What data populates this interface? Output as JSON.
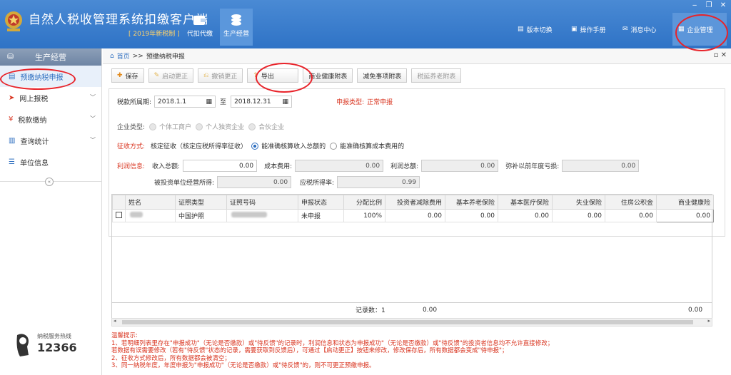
{
  "app": {
    "title": "自然人税收管理系统扣缴客户端",
    "subtitle": "[ 2019年新税制 ]"
  },
  "modules": [
    {
      "label": "代扣代缴",
      "icon": "wallet-icon"
    },
    {
      "label": "生产经营",
      "icon": "coins-icon"
    }
  ],
  "top_buttons": {
    "version": "版本切换",
    "manual": "操作手册",
    "messages": "消息中心",
    "enterprise": "企业管理"
  },
  "sidebar": {
    "header": "生产经营",
    "items": [
      {
        "label": "预缴纳税申报",
        "icon": "clipboard-icon"
      },
      {
        "label": "网上报税",
        "icon": "send-icon"
      },
      {
        "label": "税款缴纳",
        "icon": "money-icon"
      },
      {
        "label": "查询统计",
        "icon": "report-icon"
      },
      {
        "label": "单位信息",
        "icon": "list-icon"
      }
    ],
    "hotline_label": "纳税服务热线",
    "hotline_number": "12366"
  },
  "breadcrumb": {
    "home": "首页",
    "sep": ">>",
    "current": "预缴纳税申报"
  },
  "toolbar": {
    "save": "保存",
    "start_correction": "启动更正",
    "cancel_correction": "撤销更正",
    "export": "导出",
    "health_insurance": "商业健康附表",
    "deduction": "减免事项附表",
    "pension": "税延养老附表"
  },
  "form": {
    "period_label": "税款所属期:",
    "period_from": "2018.1.1",
    "period_to_sep": "至",
    "period_to": "2018.12.31",
    "declare_type_label": "申报类型:",
    "declare_type_value": "正常申报",
    "enterprise_type_label": "企业类型:",
    "enterprise_types": [
      "个体工商户",
      "个人独资企业",
      "合伙企业"
    ],
    "levy_label": "征收方式:",
    "levy_prefix": "核定征收（核定应税所得率征收）",
    "levy_options": [
      "能准确核算收入总额的",
      "能准确核算成本费用的"
    ],
    "profit_label": "利润信息:",
    "revenue_label": "收入总额:",
    "revenue": "0.00",
    "cost_label": "成本费用:",
    "cost": "0.00",
    "profit_total_label": "利润总额:",
    "profit_total": "0.00",
    "loss_label": "弥补以前年度亏损:",
    "loss": "0.00",
    "invested_income_label": "被投资单位经营所得:",
    "invested_income": "0.00",
    "tax_rate_label": "应税所得率:",
    "tax_rate": "0.99"
  },
  "table": {
    "headers": [
      "姓名",
      "证照类型",
      "证照号码",
      "申报状态",
      "分配比例",
      "投资者减除费用",
      "基本养老保险",
      "基本医疗保险",
      "失业保险",
      "住房公积金",
      "商业健康险"
    ],
    "rows": [
      {
        "id_type": "中国护照",
        "status": "未申报",
        "ratio": "100%",
        "deduct": "0.00",
        "pension": "0.00",
        "medical": "0.00",
        "unemploy": "0.00",
        "housing": "0.00",
        "health": "0.00"
      }
    ],
    "record_count_label": "记录数：1",
    "sum_deduct": "0.00",
    "sum_health": "0.00"
  },
  "tips": {
    "title": "温馨提示:",
    "lines": [
      "1、若明细列表里存在\"申报成功\"（无论是否缴款）或\"待反馈\"的记录时，利润信息和状态为申报成功\"（无论是否缴款）或\"待反馈\"的投资者信息均不允许直接修改；",
      "     若数据有误需要修改（若有\"待反馈\"状态的记录，需要获取到反馈后），可通过【启动更正】按钮来修改，修改保存后，所有数据都会变成\"待申报\"；",
      "2、征收方式修改后，所有数据都会被清空；",
      "3、同一纳税年度，年度申报为\"申报成功\"（无论是否缴款）或\"待反馈\"的，则不可更正预缴申报。"
    ]
  },
  "colors": {
    "brand": "#2f73c6",
    "highlight_circle": "#e8232a",
    "label_red": "#d9341f"
  }
}
